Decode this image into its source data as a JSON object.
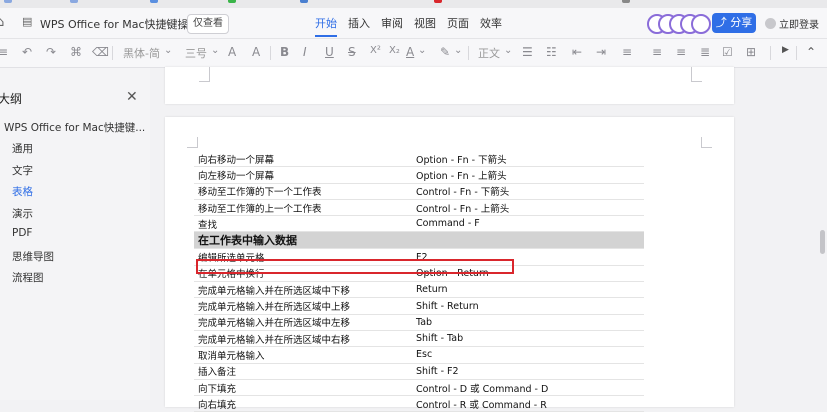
{
  "bookmarks": [
    "",
    "",
    "",
    "",
    "",
    "",
    ""
  ],
  "titlebar": {
    "doc_title": "WPS Office for Mac快捷键操...",
    "readonly_label": "仅查看",
    "tabs": [
      "开始",
      "插入",
      "审阅",
      "视图",
      "页面",
      "效率"
    ],
    "active_tab": "开始",
    "share_label": "分享",
    "login_label": "立即登录"
  },
  "toolbar": {
    "font_name": "黑体-简",
    "font_size": "三号",
    "paragraph_style": "正文"
  },
  "outline": {
    "title": "大纲",
    "doc_item": "WPS Office for Mac快捷键...",
    "items": [
      "通用",
      "文字",
      "表格",
      "演示",
      "PDF",
      "思维导图",
      "流程图"
    ],
    "active_item": "表格"
  },
  "table": {
    "rows": [
      {
        "action": "向右移动一个屏幕",
        "keys": "Option - Fn - 下箭头"
      },
      {
        "action": "向左移动一个屏幕",
        "keys": "Option - Fn - 上箭头"
      },
      {
        "action": "移动至工作簿的下一个工作表",
        "keys": "Control - Fn - 下箭头"
      },
      {
        "action": "移动至工作簿的上一个工作表",
        "keys": "Control - Fn - 上箭头"
      },
      {
        "action": "查找",
        "keys": "Command - F"
      },
      {
        "action": "在工作表中输入数据",
        "keys": "",
        "header": true
      },
      {
        "action": "编辑所选单元格",
        "keys": "F2"
      },
      {
        "action": "在单元格中换行",
        "keys": "Option - Return",
        "highlighted": true
      },
      {
        "action": "完成单元格输入并在所选区域中下移",
        "keys": "Return"
      },
      {
        "action": "完成单元格输入并在所选区域中上移",
        "keys": "Shift - Return"
      },
      {
        "action": "完成单元格输入并在所选区域中左移",
        "keys": "Tab"
      },
      {
        "action": "完成单元格输入并在所选区域中右移",
        "keys": "Shift - Tab"
      },
      {
        "action": "取消单元格输入",
        "keys": "Esc"
      },
      {
        "action": "插入备注",
        "keys": "Shift - F2"
      },
      {
        "action": "向下填充",
        "keys": "Control - D 或 Command - D"
      },
      {
        "action": "向右填充",
        "keys": "Control - R 或 Command - R"
      }
    ]
  },
  "colors": {
    "accent": "#2f6ee6",
    "highlight_border": "#d9262c",
    "header_row": "#d3d3d3"
  }
}
